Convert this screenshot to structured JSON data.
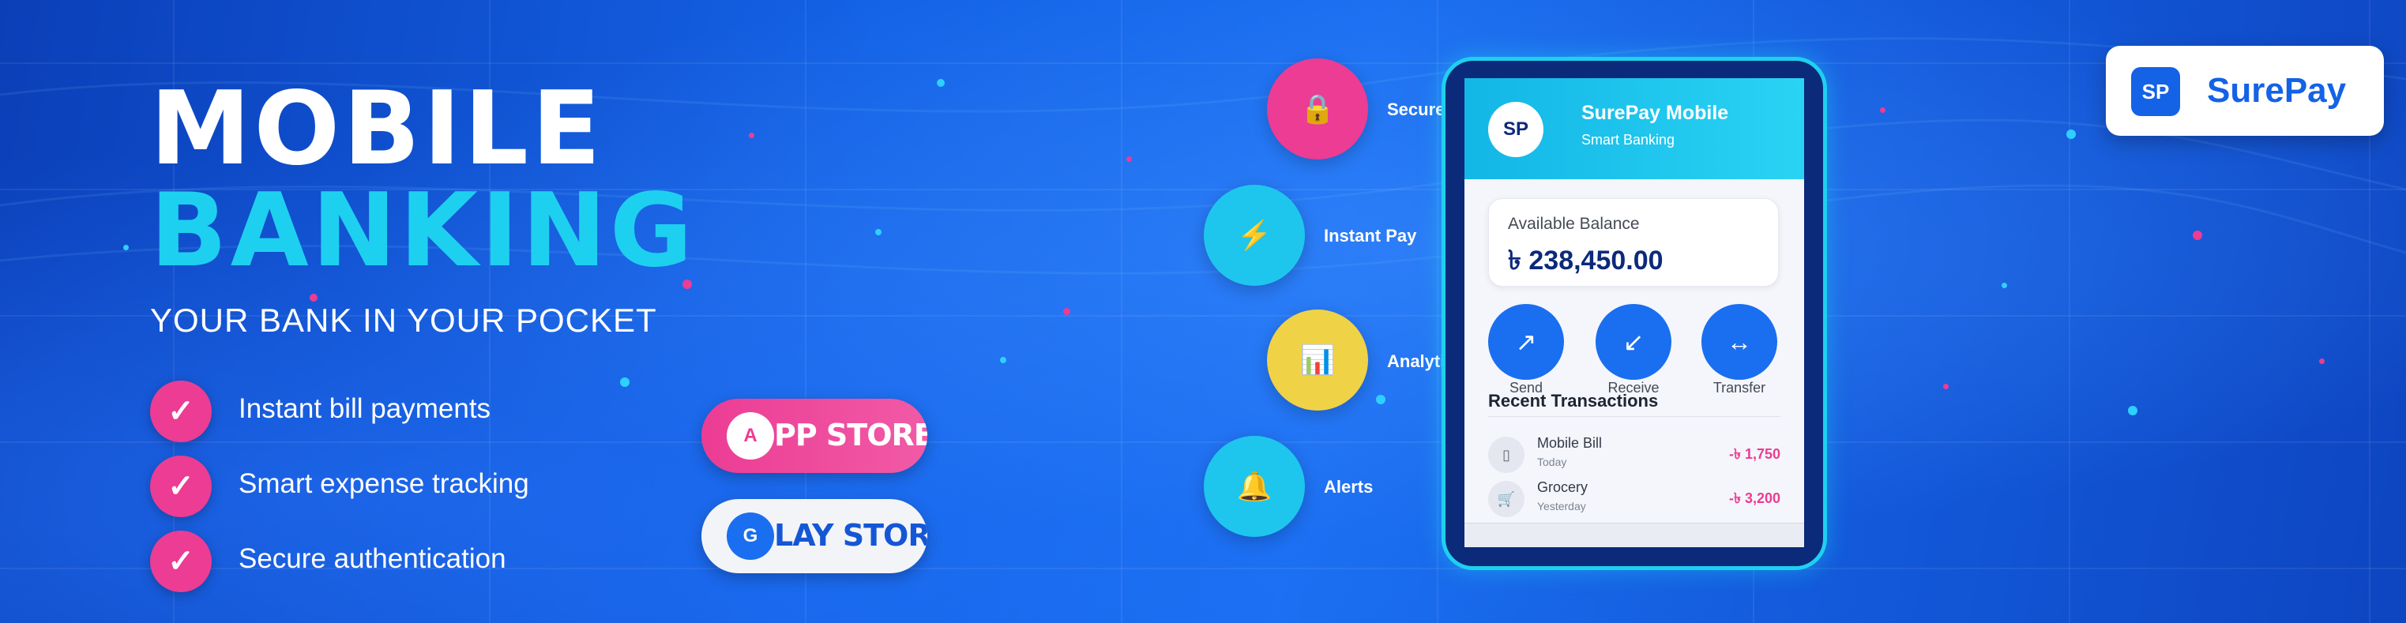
{
  "headline": {
    "line1": "MOBILE",
    "line2": "BANKING",
    "tagline": "YOUR BANK IN YOUR POCKET"
  },
  "features": [
    {
      "check": "✓",
      "text": "Instant bill payments"
    },
    {
      "check": "✓",
      "text": "Smart expense tracking"
    },
    {
      "check": "✓",
      "text": "Secure authentication"
    }
  ],
  "store_buttons": {
    "appstore": {
      "badge": "A",
      "label": "PP STORE"
    },
    "playstore": {
      "badge": "G",
      "label": "LAY STORE"
    }
  },
  "bubbles": [
    {
      "icon": "🔒",
      "icon_name": "lock-icon",
      "label": "Secure Login"
    },
    {
      "icon": "⚡",
      "icon_name": "lightning-icon",
      "label": "Instant Pay"
    },
    {
      "icon": "📊",
      "icon_name": "chart-icon",
      "label": "Analytics"
    },
    {
      "icon": "🔔",
      "icon_name": "bell-icon",
      "label": "Alerts"
    }
  ],
  "phone": {
    "avatar": "SP",
    "app_name": "SurePay Mobile",
    "app_subtitle": "Smart Banking",
    "balance_label": "Available Balance",
    "balance_amount": "৳ 238,450.00",
    "actions": [
      {
        "icon": "↗",
        "label": "Send"
      },
      {
        "icon": "↙",
        "label": "Receive"
      },
      {
        "icon": "↔",
        "label": "Transfer"
      }
    ],
    "recent_title": "Recent Transactions",
    "transactions": [
      {
        "icon": "▯",
        "name": "Mobile Bill",
        "date": "Today",
        "amount": "-৳ 1,750"
      },
      {
        "icon": "🛒",
        "name": "Grocery",
        "date": "Yesterday",
        "amount": "-৳ 3,200"
      }
    ]
  },
  "logo": {
    "badge": "SP",
    "name": "SurePay"
  },
  "colors": {
    "background": "#1462e6",
    "accent_cyan": "#1ed0f0",
    "accent_pink": "#ec3c94",
    "accent_yellow": "#f0d246",
    "navy": "#0c2a7a"
  }
}
